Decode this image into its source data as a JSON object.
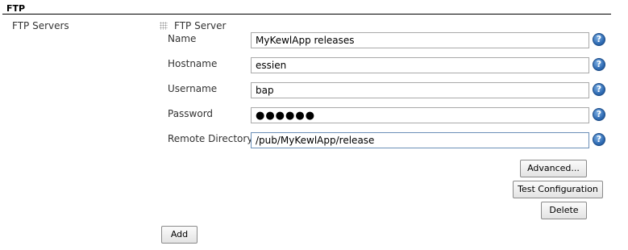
{
  "section": {
    "title": "FTP"
  },
  "ftp_servers": {
    "label": "FTP Servers",
    "server_block_title": "FTP Server",
    "fields": {
      "name": {
        "label": "Name",
        "value": "MyKewlApp releases"
      },
      "hostname": {
        "label": "Hostname",
        "value": "essien"
      },
      "username": {
        "label": "Username",
        "value": "bap"
      },
      "password": {
        "label": "Password",
        "value": "●●●●●●"
      },
      "remote_directory": {
        "label": "Remote Directory",
        "value": "/pub/MyKewlApp/release"
      }
    },
    "help_glyph": "?",
    "buttons": {
      "advanced": "Advanced...",
      "test_configuration": "Test Configuration",
      "delete": "Delete",
      "add": "Add"
    }
  },
  "icons": {
    "help": "help-icon",
    "drag": "drag-handle-icon"
  },
  "colors": {
    "help_blue": "#2f6bb3",
    "section_rule": "#000000"
  }
}
